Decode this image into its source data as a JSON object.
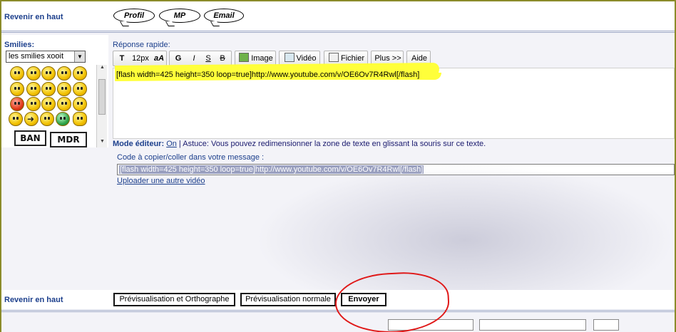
{
  "top": {
    "back_to_top": "Revenir en haut",
    "profile": "Profil",
    "mp": "MP",
    "email": "Email"
  },
  "smilies": {
    "label": "Smilies:",
    "select_value": "les smilies xooit",
    "signs": [
      "BAN",
      "MDR"
    ]
  },
  "reply": {
    "label": "Réponse rapide:",
    "toolbar": {
      "font_size": "12px",
      "bold": "G",
      "italic": "I",
      "underline": "S",
      "strike": "B",
      "image": "Image",
      "video": "Vidéo",
      "file": "Fichier",
      "more": "Plus >>",
      "help": "Aide"
    },
    "editor_text": "[flash width=425 height=350 loop=true]http://www.youtube.com/v/OE6Ov7R4Rwl[/flash]",
    "mode_label": "Mode éditeur:",
    "mode_value": "On",
    "tip": " | Astuce: Vous pouvez redimensionner la zone de texte en glissant la souris sur ce texte.",
    "code_label": "Code à copier/coller dans votre message :",
    "code_value": "[flash width=425 height=350 loop=true]http://www.youtube.com/v/OE6Ov7R4Rwl[/flash]",
    "upload_link": "Uploader une autre vidéo"
  },
  "bottom": {
    "back_to_top": "Revenir en haut",
    "preview_spell": "Prévisualisation et Orthographe",
    "preview": "Prévisualisation normale",
    "send": "Envoyer"
  },
  "colors": {
    "highlight": "#ffff3a",
    "annotation": "#e01818",
    "label_blue": "#1c3f8c"
  }
}
